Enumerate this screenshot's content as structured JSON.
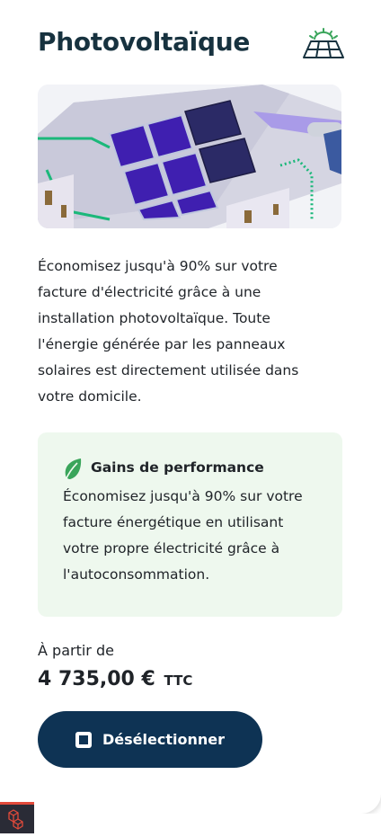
{
  "product": {
    "title": "Photovoltaïque",
    "title_icon": "solar-panel-icon",
    "description": "Économisez jusqu'à 90% sur votre facture d'électricité grâce à une installation photovoltaïque. Toute l'énergie générée par les panneaux solaires est directement utilisée dans votre domicile."
  },
  "performance": {
    "icon": "leaf-icon",
    "title": "Gains de performance",
    "text": "Économisez jusqu'à 90% sur votre facture énergétique en utilisant votre propre électricité grâce à l'autoconsommation."
  },
  "pricing": {
    "label": "À partir de",
    "amount": "4 735,00 €",
    "suffix": "TTC"
  },
  "action": {
    "label": "Désélectionner",
    "icon": "checkbox-selected-icon"
  },
  "colors": {
    "title": "#17323f",
    "button_bg": "#0e3354",
    "panel_bg": "#eef8ee",
    "leaf": "#3aa55b"
  }
}
